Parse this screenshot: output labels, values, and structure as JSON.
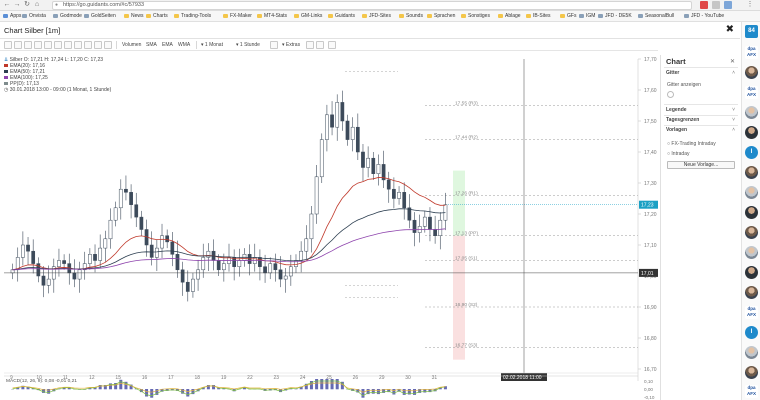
{
  "browser": {
    "url": "https://go.guidants.com/#c/57933",
    "apps_label": "Apps",
    "bookmarks": [
      {
        "label": "Onvista",
        "folder": false
      },
      {
        "label": "Godmode",
        "folder": false
      },
      {
        "label": "GoldSeiten",
        "folder": false
      },
      {
        "label": "News",
        "folder": true
      },
      {
        "label": "Charts",
        "folder": true
      },
      {
        "label": "Trading-Tools",
        "folder": true
      },
      {
        "label": "FX-Maker",
        "folder": true
      },
      {
        "label": "MT4-Stats",
        "folder": true
      },
      {
        "label": "GM-Links",
        "folder": true
      },
      {
        "label": "Guidants",
        "folder": true
      },
      {
        "label": "JFD-Sites",
        "folder": true
      },
      {
        "label": "Sounds",
        "folder": true
      },
      {
        "label": "Sprachen",
        "folder": true
      },
      {
        "label": "Sonstiges",
        "folder": true
      },
      {
        "label": "Ablage",
        "folder": true
      },
      {
        "label": "IB-Sites",
        "folder": true
      },
      {
        "label": "GFs",
        "folder": true
      },
      {
        "label": "IGM",
        "folder": false
      },
      {
        "label": "JFD - DE5K",
        "folder": false
      },
      {
        "label": "SeasonalBull",
        "folder": false
      },
      {
        "label": "JFD - YouTube",
        "folder": false
      }
    ]
  },
  "page": {
    "title": "Chart Silber [1m]"
  },
  "toolbar": {
    "items": [
      "Volumen",
      "SMA",
      "EMA",
      "WMA",
      "1 Monat",
      "1 Stunde",
      "Extras"
    ]
  },
  "legend": {
    "symbol": "Silber",
    "ohlc": "O: 17,21 H: 17,24 L: 17,20 C: 17,23",
    "ema20": "EMA(20): 17,16",
    "ema50": "EMA(50): 17,21",
    "ema100": "EMA(100): 17,25",
    "pp": "PP(D): 17,13",
    "date": "30.01.2018 13:00 - 09:00",
    "period": "(1 Monat, 1 Stunde)",
    "colors": {
      "ema20": "#c0392b",
      "ema50": "#2c3e50",
      "ema100": "#8e44ad",
      "pp": "#7f8c8d"
    }
  },
  "chart_data": {
    "type": "candlestick",
    "y_ticks": [
      "17,70",
      "17,60",
      "17,50",
      "17,40",
      "17,30",
      "17,20",
      "17,10",
      "17,00",
      "16,90",
      "16,80",
      "16,70"
    ],
    "y_range": [
      16.7,
      17.7
    ],
    "x_ticks": [
      "9",
      "10",
      "11",
      "12",
      "15",
      "16",
      "17",
      "18",
      "19",
      "22",
      "23",
      "24",
      "25",
      "26",
      "29",
      "30",
      "31"
    ],
    "current_price": "17,23",
    "crosshair_price": "17,01",
    "crosshair_date": "02.02.2018 11:00",
    "pivots": [
      {
        "label": "17,55 (R3)",
        "value": 17.55
      },
      {
        "label": "17,44 (R2)",
        "value": 17.44
      },
      {
        "label": "17,26 (R1)",
        "value": 17.26
      },
      {
        "label": "17,13 (PP)",
        "value": 17.13
      },
      {
        "label": "17,05 (S1)",
        "value": 17.05
      },
      {
        "label": "16,90 (S2)",
        "value": 16.9
      },
      {
        "label": "16,77 (S3)",
        "value": 16.77
      }
    ],
    "close_series": [
      17.02,
      17.06,
      17.1,
      17.08,
      17.04,
      17.0,
      16.97,
      16.99,
      17.03,
      17.05,
      17.04,
      17.01,
      16.99,
      17.02,
      17.04,
      17.07,
      17.05,
      17.09,
      17.12,
      17.18,
      17.22,
      17.28,
      17.27,
      17.23,
      17.19,
      17.15,
      17.1,
      17.06,
      17.09,
      17.13,
      17.11,
      17.07,
      17.02,
      16.98,
      16.95,
      16.99,
      17.02,
      17.06,
      17.08,
      17.05,
      17.02,
      17.04,
      17.06,
      17.03,
      17.05,
      17.07,
      17.04,
      17.06,
      17.03,
      17.01,
      17.04,
      17.02,
      16.99,
      17.0,
      17.03,
      17.05,
      17.08,
      17.12,
      17.2,
      17.32,
      17.44,
      17.52,
      17.48,
      17.56,
      17.5,
      17.44,
      17.48,
      17.4,
      17.35,
      17.38,
      17.33,
      17.36,
      17.31,
      17.28,
      17.25,
      17.27,
      17.22,
      17.18,
      17.14,
      17.16,
      17.19,
      17.15,
      17.13,
      17.18,
      17.23
    ],
    "indicator": {
      "label": "MACD(12, 26, 9): 0,08 -0,01 0,21",
      "y_ticks": [
        "0,10",
        "0,00",
        "-0,10"
      ]
    }
  },
  "panel": {
    "title": "Chart",
    "sections": {
      "gitter": "Gitter",
      "gitter_anzeigen": "Gitter anzeigen",
      "legende": "Legende",
      "tagesgrenzen": "Tagesgrenzen",
      "vorlagen": "Vorlagen",
      "fx_trading": "FX-Trading Intraday",
      "intraday": "Intraday",
      "neue_vorlage": "Neue Vorlage..."
    }
  },
  "sidebar": {
    "badge_count": "84",
    "logo_text": "dpa AFX"
  }
}
